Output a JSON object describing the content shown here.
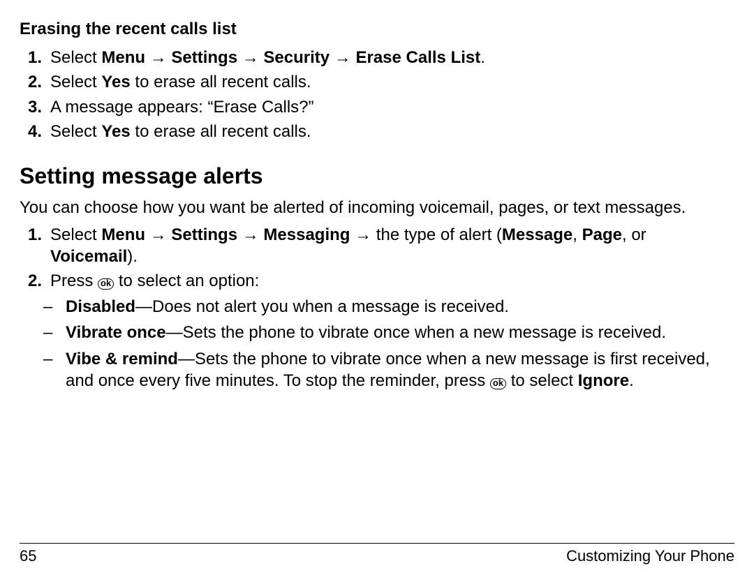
{
  "section1": {
    "heading": "Erasing the recent calls list",
    "steps": [
      {
        "num": "1.",
        "pre": "Select ",
        "b1": "Menu",
        "arr1": " → ",
        "b2": "Settings",
        "arr2": " → ",
        "b3": "Security",
        "arr3": " → ",
        "b4": "Erase Calls List",
        "post": "."
      },
      {
        "num": "2.",
        "pre": "Select ",
        "b1": "Yes",
        "post": " to erase all recent calls."
      },
      {
        "num": "3.",
        "text": "A message appears: “Erase Calls?”"
      },
      {
        "num": "4.",
        "pre": "Select ",
        "b1": "Yes",
        "post": " to erase all recent calls."
      }
    ]
  },
  "section2": {
    "heading": "Setting message alerts",
    "intro": "You can choose how you want be alerted of incoming voicemail, pages, or text messages.",
    "step1": {
      "num": "1.",
      "pre": "Select ",
      "b1": "Menu",
      "arr1": " → ",
      "b2": "Settings",
      "arr2": " → ",
      "b3": "Messaging",
      "arr3": " → ",
      "mid": "the type of alert (",
      "b4": "Message",
      "sep1": ", ",
      "b5": "Page",
      "sep2": ", or ",
      "b6": "Voicemail",
      "post": ")."
    },
    "step2": {
      "num": "2.",
      "pre": "Press ",
      "ok": "ok",
      "post": " to select an option:"
    },
    "bullets": [
      {
        "b": "Disabled",
        "rest": "—Does not alert you when a message is received."
      },
      {
        "b": "Vibrate once",
        "rest": "—Sets the phone to vibrate once when a new message is received."
      },
      {
        "b": "Vibe & remind",
        "rest1": "—Sets the phone to vibrate once when a new message is first received, and once every five minutes. To stop the reminder, press ",
        "ok": "ok",
        "rest2": " to select ",
        "b2": "Ignore",
        "rest3": "."
      }
    ]
  },
  "footer": {
    "page": "65",
    "title": "Customizing Your Phone"
  },
  "dash": "–"
}
